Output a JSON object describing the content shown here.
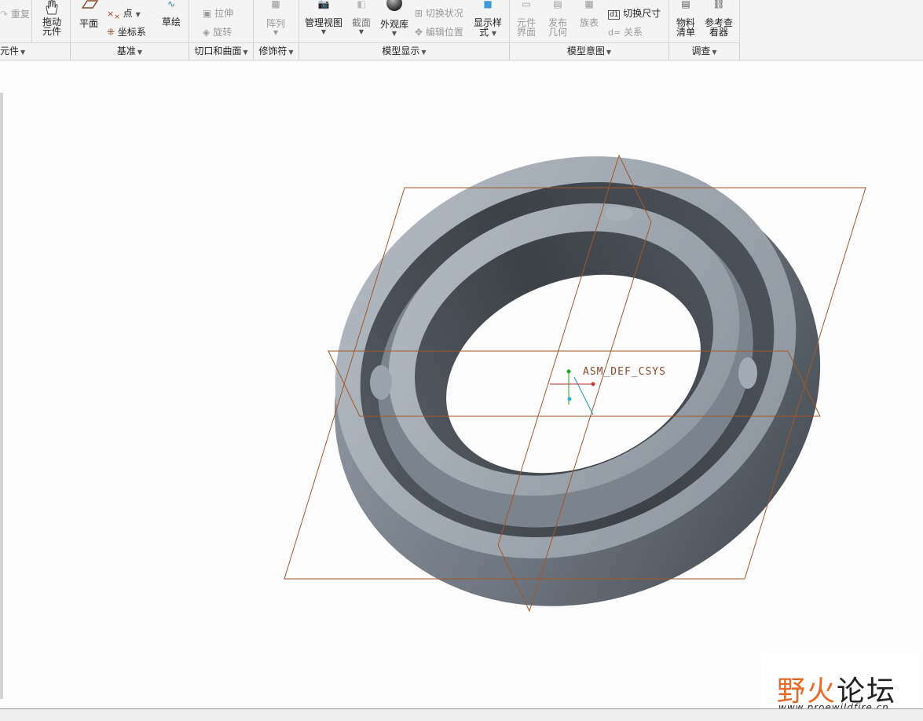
{
  "ribbon": {
    "buttons": {
      "redo": "重复",
      "drag_component": [
        "拖动",
        "元件"
      ],
      "plane": "平面",
      "point": "点",
      "csys": "坐标系",
      "sketch": "草绘",
      "extrude": "拉伸",
      "revolve": "旋转",
      "pattern": "阵列",
      "manage_views": "管理视图",
      "section": "截面",
      "appearance_gallery": "外观库",
      "toggle_status": "切换状况",
      "edit_position": "编辑位置",
      "display_style": [
        "显示样",
        "式"
      ],
      "component_interface": [
        "元件",
        "界面"
      ],
      "publish_geometry": [
        "发布",
        "几何"
      ],
      "family_table": "族表",
      "switch_dimensions": "切换尺寸",
      "relations": "关系",
      "bom": [
        "物料",
        "清单"
      ],
      "reference_viewer": [
        "参考查",
        "看器"
      ]
    },
    "groups": {
      "component": "元件",
      "datum": "基准",
      "cut_surface": "切口和曲面",
      "modifiers": "修饰符",
      "model_display": "模型显示",
      "model_intent": "模型意图",
      "investigate": "调查"
    }
  },
  "viewport": {
    "csys_label": "ASM_DEF_CSYS",
    "model_fill": "#8a929c",
    "datum_color": "#a0582c"
  },
  "watermark": {
    "title_part1": "野火",
    "title_part2": "论坛",
    "url": "www.proewildfire.cn"
  },
  "colors": {
    "ribbon_bg": "#f4f4f4",
    "canvas_bg": "#fdfcfd",
    "accent_orange": "#e46a25"
  }
}
